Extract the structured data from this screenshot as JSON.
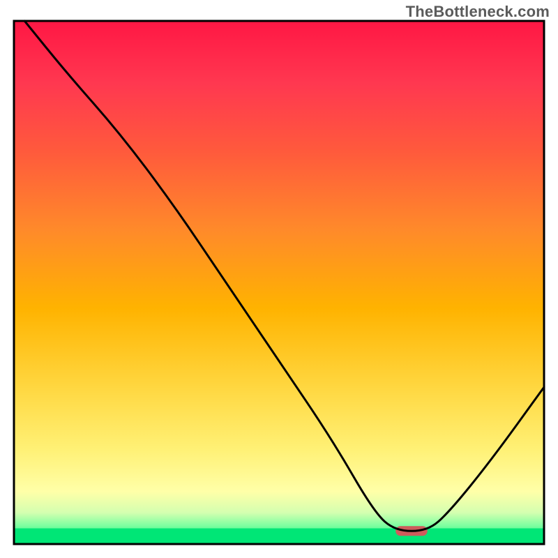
{
  "watermark": "TheBottleneck.com",
  "chart_data": {
    "type": "line",
    "title": "",
    "xlabel": "",
    "ylabel": "",
    "xlim": [
      0,
      100
    ],
    "ylim": [
      0,
      100
    ],
    "grid": false,
    "series": [
      {
        "name": "curve",
        "x": [
          2,
          10,
          20,
          30,
          40,
          50,
          60,
          68,
          72,
          78,
          82,
          90,
          100
        ],
        "y": [
          100,
          90,
          78.5,
          65,
          50,
          35,
          20,
          6,
          2.5,
          2.5,
          6,
          16,
          30
        ]
      }
    ],
    "marker_region": {
      "x_start": 72,
      "x_end": 78,
      "color": "#cd5c5c"
    },
    "green_band": {
      "y_start": 0,
      "y_end": 3,
      "color": "#00e676"
    },
    "gradient_stops": [
      {
        "offset": 0.0,
        "color": "#ff1744"
      },
      {
        "offset": 0.12,
        "color": "#ff3850"
      },
      {
        "offset": 0.25,
        "color": "#ff5a3c"
      },
      {
        "offset": 0.4,
        "color": "#ff8a2a"
      },
      {
        "offset": 0.55,
        "color": "#ffb300"
      },
      {
        "offset": 0.7,
        "color": "#ffd740"
      },
      {
        "offset": 0.82,
        "color": "#fff176"
      },
      {
        "offset": 0.9,
        "color": "#ffffa8"
      },
      {
        "offset": 0.94,
        "color": "#d4ffb0"
      },
      {
        "offset": 0.965,
        "color": "#7cffa0"
      },
      {
        "offset": 1.0,
        "color": "#00e676"
      }
    ]
  }
}
